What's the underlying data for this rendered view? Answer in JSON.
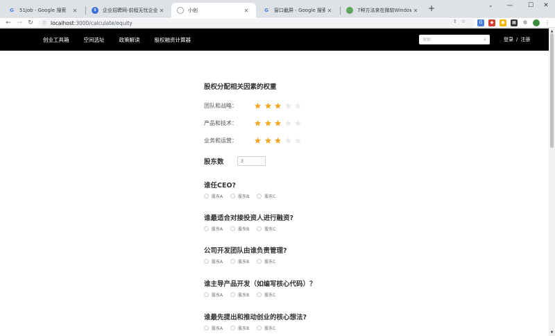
{
  "browser": {
    "tabs": [
      {
        "title": "51job - Google 搜索",
        "icon": "google-icon",
        "active": false
      },
      {
        "title": "企业招聘网-前程无忧企业版-51job",
        "icon": "51job-icon",
        "active": false
      },
      {
        "title": "小创",
        "icon": "globe-icon",
        "active": true
      },
      {
        "title": "窗口截屏 - Google 搜索",
        "icon": "google-icon",
        "active": false
      },
      {
        "title": "7种方法来在微软Windows系统",
        "icon": "site-icon",
        "active": false
      }
    ],
    "new_tab": "+",
    "url_host": "localhost",
    "url_path": ":3000/calculate/equity"
  },
  "header": {
    "nav": [
      "创业工具箱",
      "空间选址",
      "政策解读",
      "股权融资计算器"
    ],
    "search_placeholder": "搜索",
    "login": "登录",
    "separator": "/",
    "register": "注册"
  },
  "weights": {
    "title": "股权分配相关因素的权重",
    "items": [
      {
        "label": "团队和战略：",
        "rating": 3,
        "max": 5
      },
      {
        "label": "产品和技术：",
        "rating": 3,
        "max": 5
      },
      {
        "label": "业务和运营：",
        "rating": 3,
        "max": 5
      }
    ],
    "star_color": "#f5a623",
    "star_empty_color": "#e8e8e8"
  },
  "shareholders": {
    "label": "股东数",
    "value": "3"
  },
  "questions": [
    {
      "title": "谁任CEO?",
      "options": [
        "股东A",
        "股东B",
        "股东C"
      ]
    },
    {
      "title": "谁最适合对接投资人进行融资?",
      "options": [
        "股东A",
        "股东B",
        "股东C"
      ]
    },
    {
      "title": "公司开发团队由谁负责管理?",
      "options": [
        "股东A",
        "股东B",
        "股东C"
      ]
    },
    {
      "title": "谁主导产品开发（如编写核心代码）？",
      "options": [
        "股东A",
        "股东B",
        "股东C"
      ]
    },
    {
      "title": "谁最先提出和推动创业的核心想法?",
      "options": [
        "股东A",
        "股东B",
        "股东C"
      ]
    }
  ]
}
